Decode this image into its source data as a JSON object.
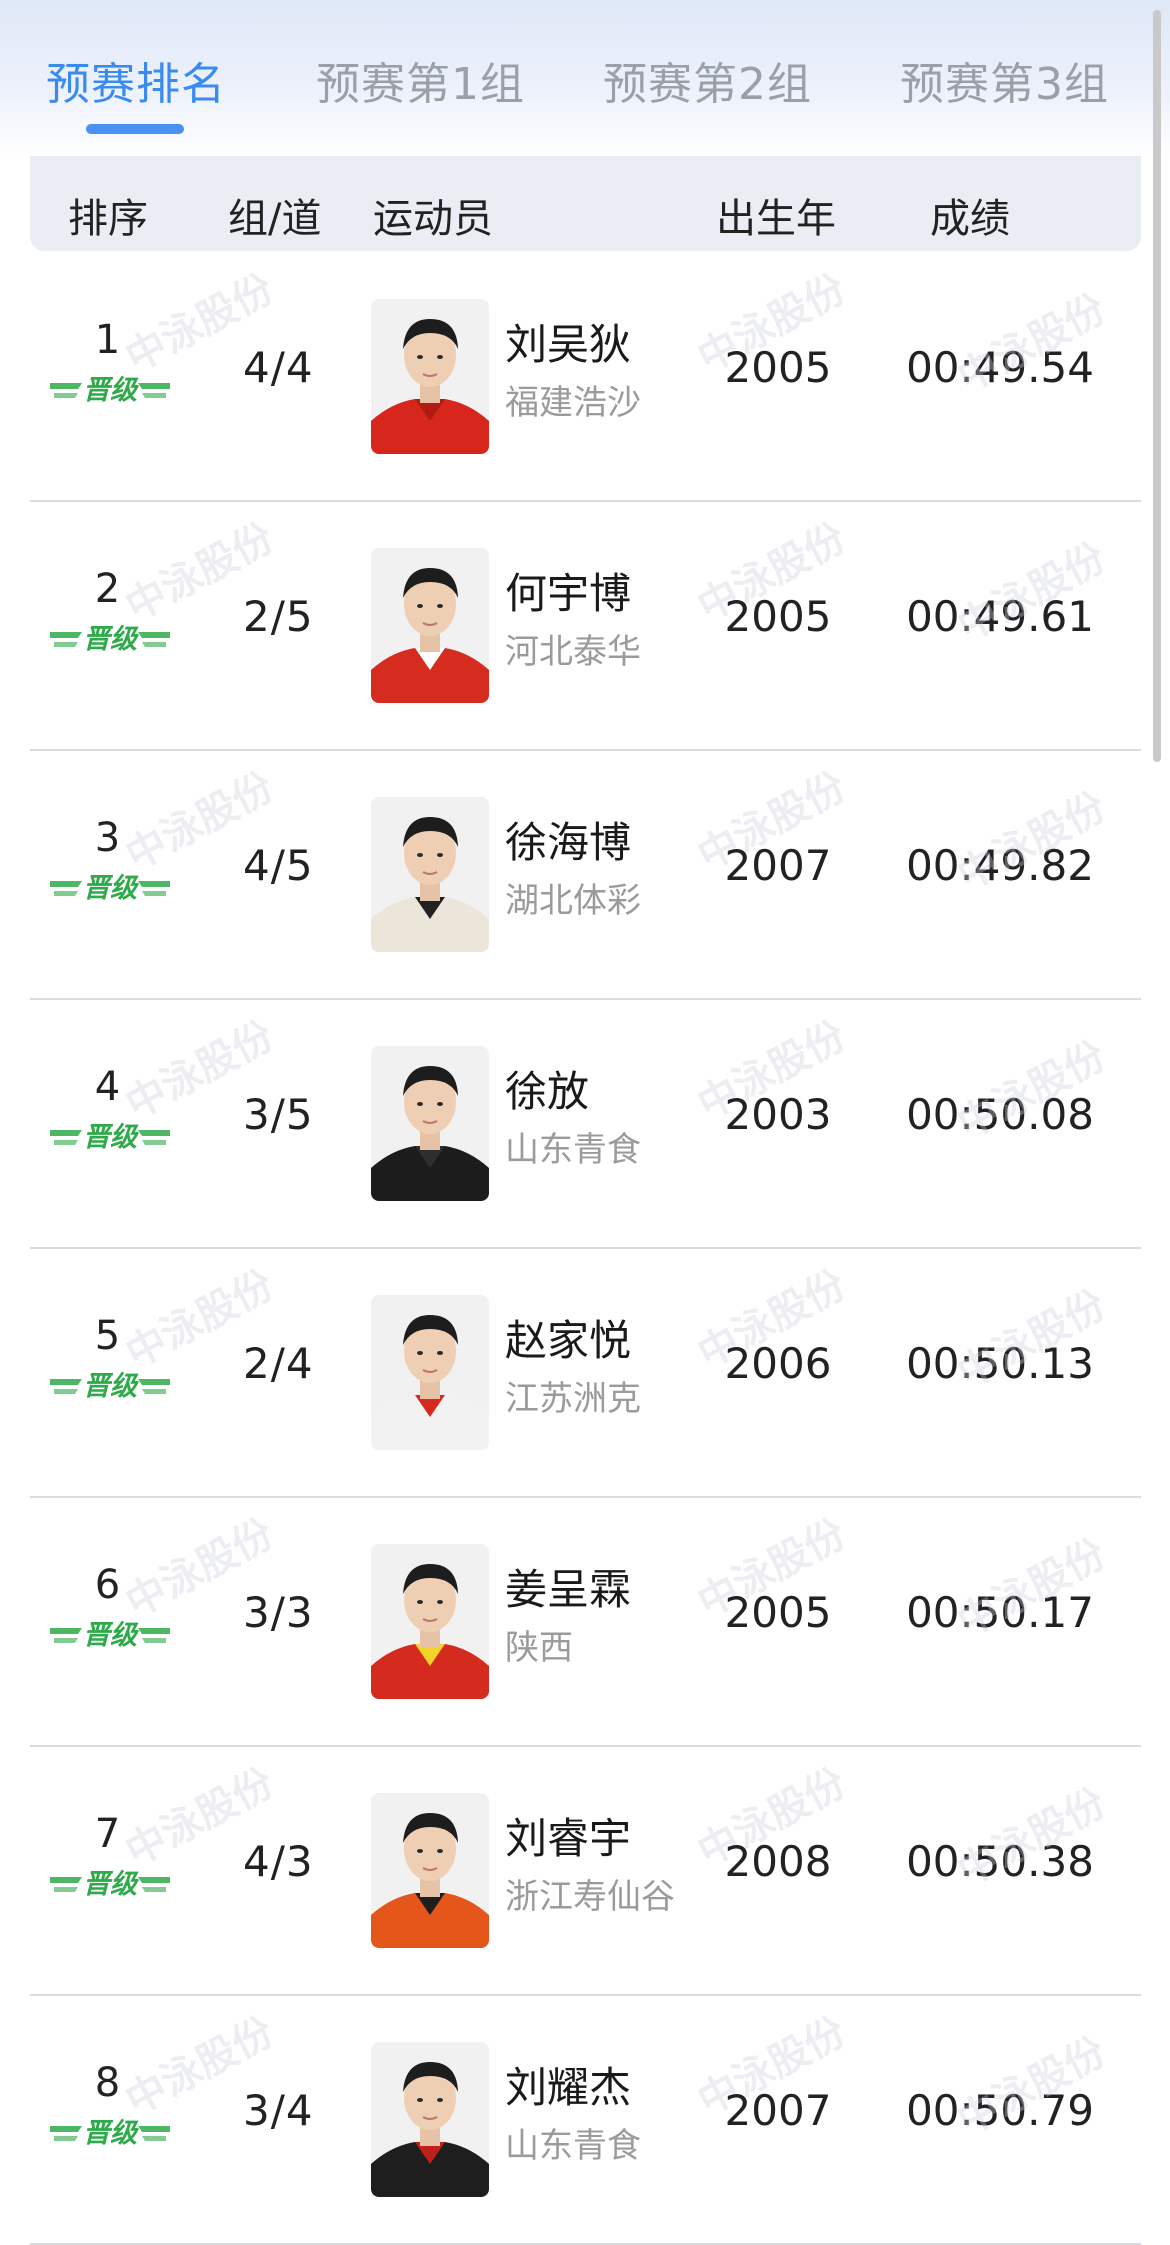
{
  "tabs": [
    {
      "label": "预赛排名",
      "active": true
    },
    {
      "label": "预赛第1组",
      "active": false
    },
    {
      "label": "预赛第2组",
      "active": false
    },
    {
      "label": "预赛第3组",
      "active": false
    }
  ],
  "table": {
    "headers": {
      "rank": "排序",
      "heat_lane": "组/道",
      "athlete": "运动员",
      "birth_year": "出生年",
      "result": "成绩"
    },
    "rows": [
      {
        "rank": "1",
        "badge": "晋级",
        "heat_lane": "4/4",
        "name": "刘吴狄",
        "team": "福建浩沙",
        "birth_year": "2005",
        "result": "00:49.54",
        "shirt": "#d7261c",
        "collar": "#b01c14"
      },
      {
        "rank": "2",
        "badge": "晋级",
        "heat_lane": "2/5",
        "name": "何宇博",
        "team": "河北泰华",
        "birth_year": "2005",
        "result": "00:49.61",
        "shirt": "#d52c1f",
        "collar": "#ffffff"
      },
      {
        "rank": "3",
        "badge": "晋级",
        "heat_lane": "4/5",
        "name": "徐海博",
        "team": "湖北体彩",
        "birth_year": "2007",
        "result": "00:49.82",
        "shirt": "#ece6da",
        "collar": "#222222"
      },
      {
        "rank": "4",
        "badge": "晋级",
        "heat_lane": "3/5",
        "name": "徐放",
        "team": "山东青食",
        "birth_year": "2003",
        "result": "00:50.08",
        "shirt": "#1c1c1c",
        "collar": "#2e2e2e"
      },
      {
        "rank": "5",
        "badge": "晋级",
        "heat_lane": "2/4",
        "name": "赵家悦",
        "team": "江苏洲克",
        "birth_year": "2006",
        "result": "00:50.13",
        "shirt": "#f2f2f2",
        "collar": "#d62a20"
      },
      {
        "rank": "6",
        "badge": "晋级",
        "heat_lane": "3/3",
        "name": "姜呈霖",
        "team": "陕西",
        "birth_year": "2005",
        "result": "00:50.17",
        "shirt": "#d52a1e",
        "collar": "#f3d22a"
      },
      {
        "rank": "7",
        "badge": "晋级",
        "heat_lane": "4/3",
        "name": "刘睿宇",
        "team": "浙江寿仙谷",
        "birth_year": "2008",
        "result": "00:50.38",
        "shirt": "#e4561a",
        "collar": "#1e1e1e"
      },
      {
        "rank": "8",
        "badge": "晋级",
        "heat_lane": "3/4",
        "name": "刘耀杰",
        "team": "山东青食",
        "birth_year": "2007",
        "result": "00:50.79",
        "shirt": "#1e1e1e",
        "collar": "#c0201a"
      }
    ]
  },
  "watermark": "中泳股份",
  "colors": {
    "accent": "#3a8bf0",
    "badge_green": "#2faa4a",
    "header_bg": "#eaedf4"
  }
}
